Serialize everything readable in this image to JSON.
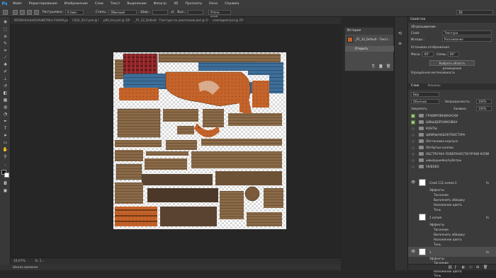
{
  "menu": {
    "app_logo": "Ps",
    "items": [
      "Файл",
      "Редактирование",
      "Изображение",
      "Слои",
      "Текст",
      "Выделение",
      "Фильтр",
      "3D",
      "Просмотр",
      "Окно",
      "Справка"
    ]
  },
  "options_bar": {
    "feather_label": "Растушевка:",
    "feather_value": "0 пикс",
    "style_label": "Стиль:",
    "style_value": "Обычный",
    "width_label": "Шир.:",
    "height_label": "Выс.:",
    "refine_button": "Уточн. край...",
    "workspace_value": "3D"
  },
  "tabs": [
    {
      "label": "90509c0ecbe014fa8874bec7ddefd.jpg @ 50% (RGB/8)",
      "active": false
    },
    {
      "label": "CSLO_50-2.psd @ 16% (RGB/8)",
      "active": false
    },
    {
      "label": "p90_tex.psd @ 16% (GL, RGB/8)",
      "active": false
    },
    {
      "label": "_P1_32_Default - Текстура по умолчанию.psd @ 16,7% (2, RGB/8)",
      "active": true
    },
    {
      "label": "unwrapped.psd @ 25% (RGB/8)",
      "active": false
    }
  ],
  "status": {
    "zoom": "16,67%",
    "doc": "Б: 1..."
  },
  "timeline_label": "Шкала времени",
  "history": {
    "title": "История",
    "snapshot": "_P1_32_Default - Текст...",
    "items": [
      "Открыть"
    ]
  },
  "properties": {
    "title": "Свойства",
    "type_label": "3D-расширение",
    "layer_label": "Слой:",
    "layer_value": "Текстура",
    "source_label": "Исходн.:",
    "source_value": "Рассеивание",
    "text_label": "Установка отображения",
    "u_label": "Масш.:",
    "u_value": "80°",
    "v_label": "Смещ.:",
    "v_value": "80°",
    "apply_button": "Выбрать область размещения",
    "extra_label": "Упрощённая интенсивность"
  },
  "layers": {
    "tabs": [
      "Слои",
      "Каналы"
    ],
    "kind_value": "Вид",
    "blend_mode": "Обычные",
    "opacity_label": "Непрозрачность:",
    "opacity_value": "100%",
    "lock_label": "Закрепить:",
    "fill_label": "Заливка:",
    "fill_value": "100%",
    "folders": [
      {
        "name": "ГРАВИРОВКИ/НАСКИ",
        "visible": true
      },
      {
        "name": "ШВЫ/ДОРОЖКОВКА",
        "visible": true
      },
      {
        "name": "КОНТЫ",
        "visible": false
      },
      {
        "name": "ЦИФРЫ/НАБОР/ТЕКСТУРА",
        "visible": false
      },
      {
        "name": "Обстановка корпуса",
        "visible": false
      },
      {
        "name": "Обтёртые колпки",
        "visible": false
      },
      {
        "name": "ОБСТРОЧКА ПОВЕРХНОСТИ РУЧКИ КОЛИ",
        "visible": false
      },
      {
        "name": "швы/рушейку/кубетры",
        "visible": false
      },
      {
        "name": "SKIBDED",
        "visible": false
      }
    ],
    "layer1": {
      "name": "Слой 112 копия 2",
      "effects_label": "Эффекты",
      "effects": [
        "Тиснение",
        "Выполнить обводку",
        "Наложение цвета",
        "Тень"
      ]
    },
    "layer2": {
      "name": "1 копия",
      "effects_label": "Эффекты",
      "effects": [
        "Тиснение",
        "Выполнить обводку",
        "Наложение цвета",
        "Тень"
      ]
    },
    "layer3": {
      "name": "1",
      "effects_label": "Эффекты",
      "effects": [
        "Тиснение",
        "Выполнить обводку",
        "Наложение цвета",
        "Тень"
      ]
    },
    "fx": "fx"
  },
  "ruler_value": "3D",
  "colors": {
    "accent": "#31a8ff",
    "wood": "#8a6a48",
    "blue": "#3d6e99",
    "orange": "#c4632a",
    "red": "#8a2426"
  }
}
